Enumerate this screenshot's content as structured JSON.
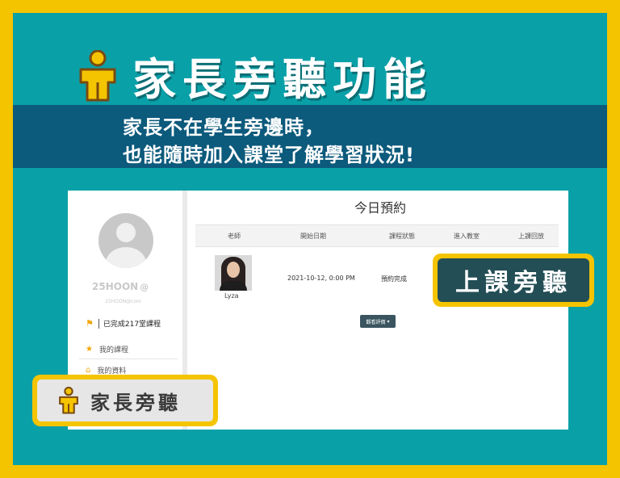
{
  "headline": "家長旁聽功能",
  "subheadline": {
    "line1": "家長不在學生旁邊時，",
    "line2": "也能隨時加入課堂了解學習狀況!"
  },
  "sidebar": {
    "username": "25HOON",
    "username_suffix": "@",
    "email": "25HOON@com",
    "completed_text": "已完成217堂課程",
    "items": [
      {
        "label": "我的課程",
        "icon": "star-icon"
      },
      {
        "label": "我的資料",
        "icon": "home-icon"
      }
    ]
  },
  "main": {
    "title": "今日預約",
    "columns": [
      "老師",
      "開始日期",
      "課程狀態",
      "進入教室",
      "上課回放"
    ],
    "rows": [
      {
        "teacher": "Lyza",
        "date": "2021-10-12, 0:00 PM",
        "status": "預約完成"
      }
    ],
    "review_button": "觀看評價"
  },
  "callouts": {
    "attend": "上課旁聽",
    "parent_listen": "家長旁聽"
  },
  "colors": {
    "frame": "#f5c400",
    "panel": "#0aa0a8",
    "band": "#0c5a7c",
    "callout_dark": "#234e55"
  }
}
